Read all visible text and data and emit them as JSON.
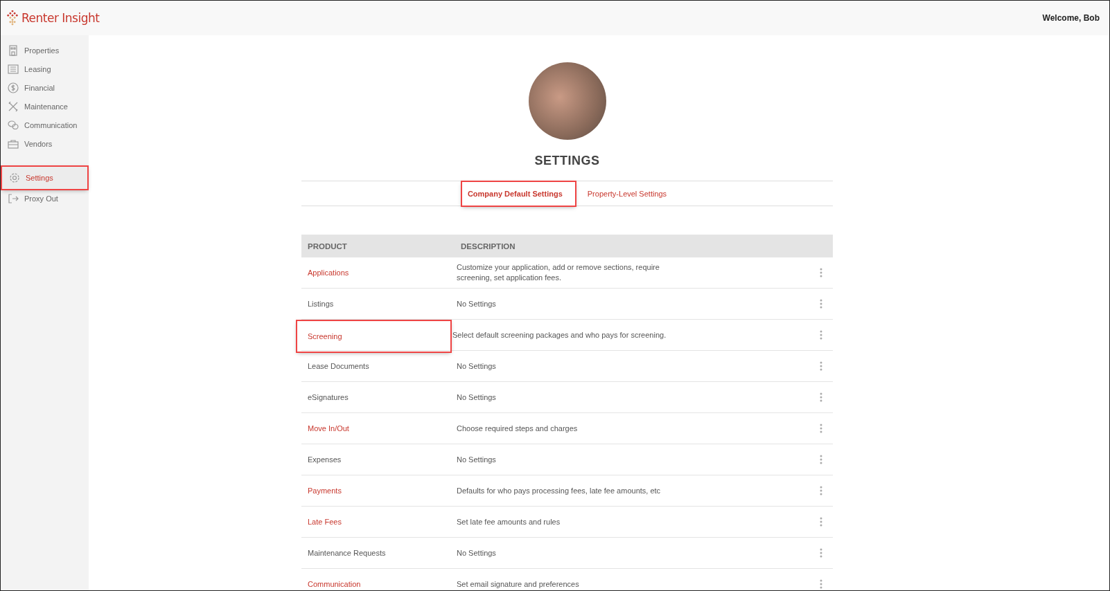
{
  "brand": {
    "name": "Renter Insight"
  },
  "header": {
    "welcome": "Welcome, Bob"
  },
  "sidebar": {
    "items": [
      {
        "label": "Properties",
        "selected": false,
        "highlighted": false
      },
      {
        "label": "Leasing",
        "selected": false,
        "highlighted": false
      },
      {
        "label": "Financial",
        "selected": false,
        "highlighted": false
      },
      {
        "label": "Maintenance",
        "selected": false,
        "highlighted": false
      },
      {
        "label": "Communication",
        "selected": false,
        "highlighted": false
      },
      {
        "label": "Vendors",
        "selected": false,
        "highlighted": false
      },
      {
        "label": "Settings",
        "selected": true,
        "highlighted": true
      },
      {
        "label": "Proxy Out",
        "selected": false,
        "highlighted": false
      }
    ]
  },
  "page": {
    "title": "SETTINGS"
  },
  "tabs": [
    {
      "label": "Company Default Settings",
      "selected": true,
      "highlighted": true
    },
    {
      "label": "Property-Level Settings",
      "selected": false,
      "highlighted": false
    }
  ],
  "table": {
    "columns": [
      "PRODUCT",
      "DESCRIPTION"
    ],
    "rows": [
      {
        "product": "Applications",
        "description": "Customize your application, add or remove sections, require screening, set application fees.",
        "linked": true,
        "highlighted": false
      },
      {
        "product": "Listings",
        "description": "No Settings",
        "linked": false,
        "highlighted": false
      },
      {
        "product": "Screening",
        "description": "Select default screening packages and who pays for screening.",
        "linked": true,
        "highlighted": true
      },
      {
        "product": "Lease Documents",
        "description": "No Settings",
        "linked": false,
        "highlighted": false
      },
      {
        "product": "eSignatures",
        "description": "No Settings",
        "linked": false,
        "highlighted": false
      },
      {
        "product": "Move In/Out",
        "description": "Choose required steps and charges",
        "linked": true,
        "highlighted": false
      },
      {
        "product": "Expenses",
        "description": "No Settings",
        "linked": false,
        "highlighted": false
      },
      {
        "product": "Payments",
        "description": "Defaults for who pays processing fees, late fee amounts, etc",
        "linked": true,
        "highlighted": false
      },
      {
        "product": "Late Fees",
        "description": "Set late fee amounts and rules",
        "linked": true,
        "highlighted": false
      },
      {
        "product": "Maintenance Requests",
        "description": "No Settings",
        "linked": false,
        "highlighted": false
      },
      {
        "product": "Communication",
        "description": "Set email signature and preferences",
        "linked": true,
        "highlighted": false
      }
    ]
  }
}
